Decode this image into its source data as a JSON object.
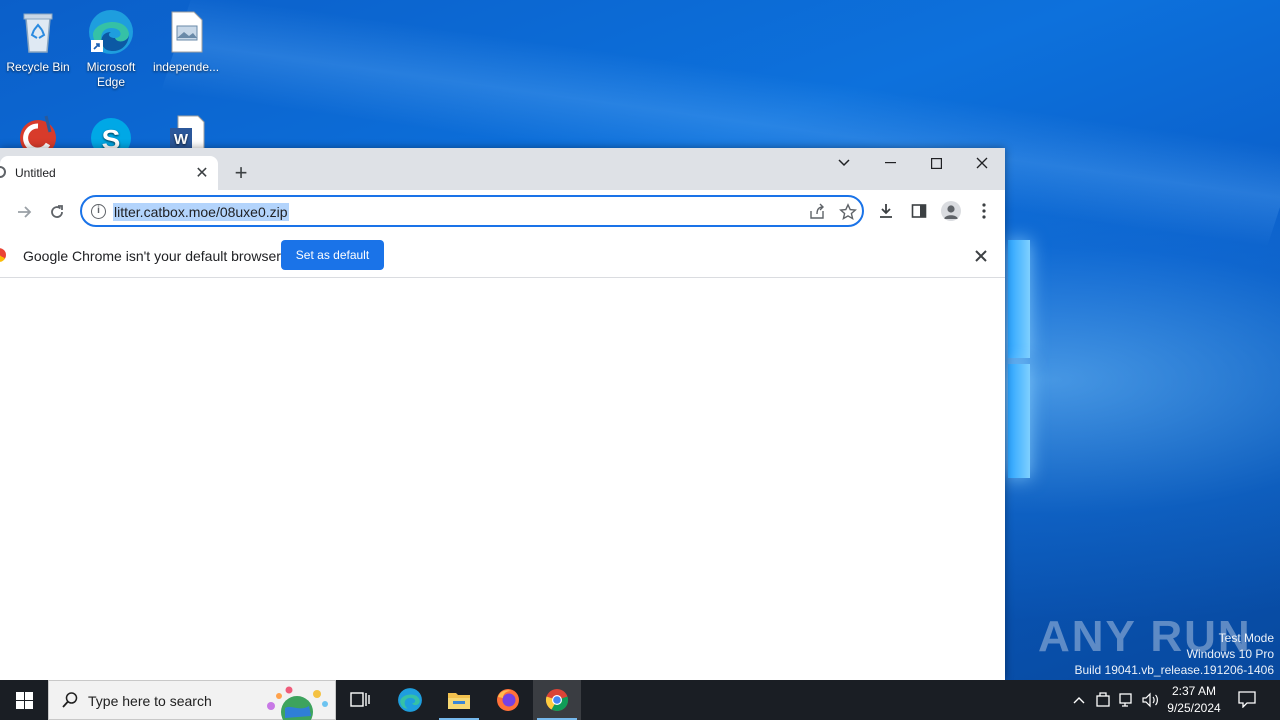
{
  "desktop": {
    "icons": [
      {
        "label": "Recycle Bin",
        "icon": "recycle-bin-icon"
      },
      {
        "label": "Microsoft Edge",
        "icon": "edge-icon"
      },
      {
        "label": "independe...",
        "icon": "image-file-icon"
      },
      {
        "label": "",
        "icon": "ccleaner-icon"
      },
      {
        "label": "",
        "icon": "skype-icon"
      },
      {
        "label": "",
        "icon": "word-document-icon"
      }
    ],
    "watermark": {
      "brand": "ANY RUN",
      "line1": "Test Mode",
      "line2": "Windows 10 Pro",
      "line3": "Build 19041.vb_release.191206-1406"
    }
  },
  "browser": {
    "tab": {
      "title": "Untitled",
      "close_glyph": "✕"
    },
    "new_tab_glyph": "+",
    "address": {
      "url": "litter.catbox.moe/08uxe0.zip",
      "selected": true
    },
    "infobar": {
      "message": "Google Chrome isn't your default browser",
      "button_label": "Set as default"
    }
  },
  "taskbar": {
    "search_placeholder": "Type here to search",
    "apps": [
      "task-view",
      "edge",
      "file-explorer",
      "firefox",
      "chrome"
    ],
    "clock": {
      "time": "2:37 AM",
      "date": "9/25/2024"
    }
  },
  "colors": {
    "accent": "#1a73e8",
    "tabstrip": "#dee1e6",
    "taskbar": "#1a1e24",
    "selection": "#b3d4fc"
  }
}
